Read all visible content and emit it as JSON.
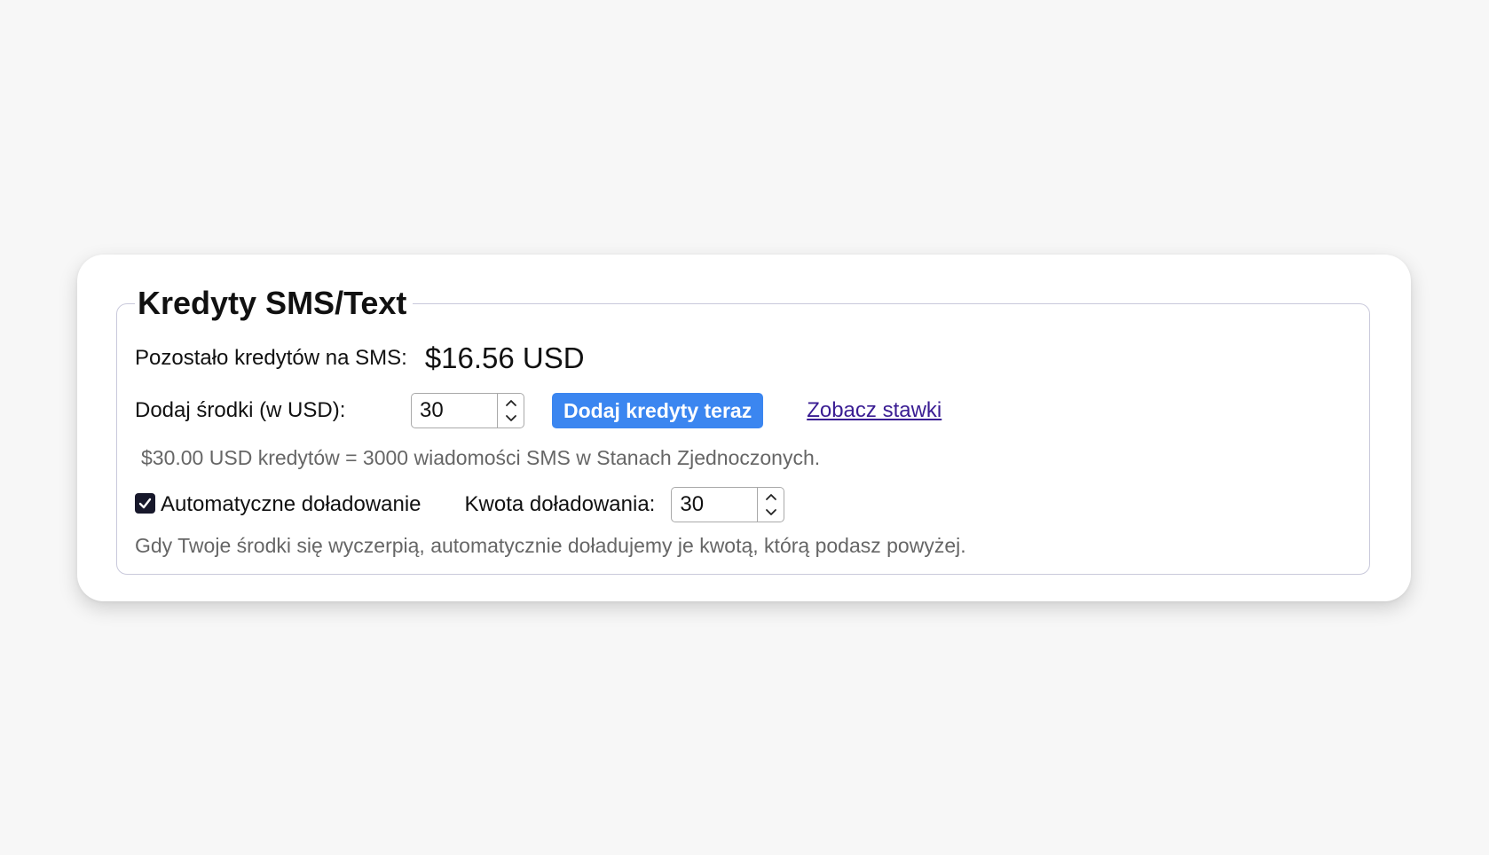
{
  "section": {
    "title": "Kredyty SMS/Text"
  },
  "balance": {
    "label": "Pozostało kredytów na SMS:",
    "value": "$16.56 USD"
  },
  "add_funds": {
    "label": "Dodaj środki (w USD):",
    "amount": "30",
    "button_label": "Dodaj kredyty teraz",
    "link_label": "Zobacz stawki",
    "info": "$30.00 USD kredytów = 3000 wiadomości SMS w Stanach Zjednoczonych."
  },
  "auto_reload": {
    "checkbox_label": "Automatyczne doładowanie",
    "checked": true,
    "amount_label": "Kwota doładowania:",
    "amount": "30",
    "info": "Gdy Twoje środki się wyczerpią, automatycznie doładujemy je kwotą, którą podasz powyżej."
  },
  "icons": {
    "stepper": "chevron-up-down-icon",
    "checkbox": "check-icon"
  },
  "colors": {
    "page_background": "#f7f7f7",
    "primary_button": "#3b86f0",
    "link": "#3a1d93",
    "checkbox": "#17182b",
    "muted_text": "#666666"
  }
}
